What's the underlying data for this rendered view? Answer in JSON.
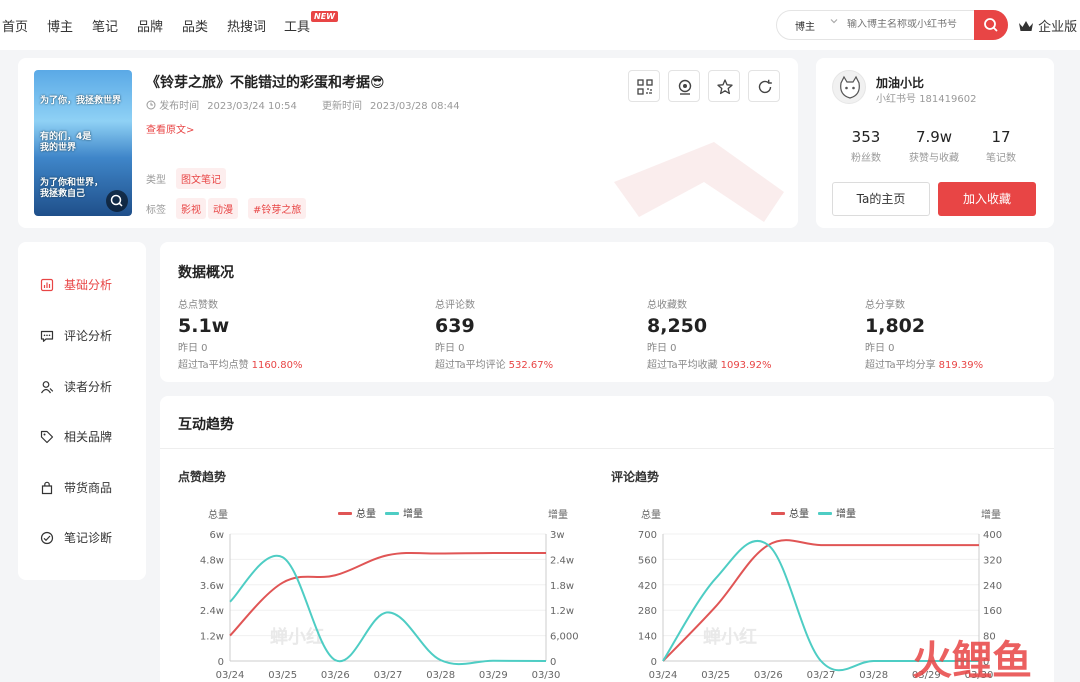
{
  "nav": {
    "items": [
      "首页",
      "博主",
      "笔记",
      "品牌",
      "品类",
      "热搜词",
      "工具"
    ],
    "new_badge": "NEW",
    "search": {
      "select": "博主",
      "placeholder": "输入博主名称或小红书号"
    },
    "enterprise": "企业版"
  },
  "note": {
    "title": "《铃芽之旅》不能错过的彩蛋和考据😎",
    "publish_label": "发布时间",
    "publish_time": "2023/03/24 10:54",
    "update_label": "更新时间",
    "update_time": "2023/03/28 08:44",
    "view_original": "查看原文>",
    "type_label": "类型",
    "type_value": "图文笔记",
    "tags_label": "标签",
    "tags": [
      "影视",
      "动漫",
      "#铃芽之旅"
    ],
    "cover_texts": [
      "为了你，我拯救世界",
      "有的们，4是我的世界",
      "为了你和世界，我拯救自己"
    ]
  },
  "blogger": {
    "name": "加油小比",
    "id_label": "小红书号",
    "id": "181419602",
    "stats": [
      {
        "value": "353",
        "label": "粉丝数"
      },
      {
        "value": "7.9w",
        "label": "获赞与收藏"
      },
      {
        "value": "17",
        "label": "笔记数"
      }
    ],
    "home_button": "Ta的主页",
    "fav_button": "加入收藏"
  },
  "sidebar": {
    "items": [
      {
        "label": "基础分析",
        "icon": "bar-chart-icon",
        "active": true
      },
      {
        "label": "评论分析",
        "icon": "comment-icon",
        "active": false
      },
      {
        "label": "读者分析",
        "icon": "user-icon",
        "active": false
      },
      {
        "label": "相关品牌",
        "icon": "tag-icon",
        "active": false
      },
      {
        "label": "带货商品",
        "icon": "bag-icon",
        "active": false
      },
      {
        "label": "笔记诊断",
        "icon": "diagnose-icon",
        "active": false
      }
    ]
  },
  "overview": {
    "title": "数据概况",
    "metrics": [
      {
        "label": "总点赞数",
        "value": "5.1w",
        "yesterday": "昨日 0",
        "compare": "超过Ta平均点赞",
        "pct": "1160.80%"
      },
      {
        "label": "总评论数",
        "value": "639",
        "yesterday": "昨日 0",
        "compare": "超过Ta平均评论",
        "pct": "532.67%"
      },
      {
        "label": "总收藏数",
        "value": "8,250",
        "yesterday": "昨日 0",
        "compare": "超过Ta平均收藏",
        "pct": "1093.92%"
      },
      {
        "label": "总分享数",
        "value": "1,802",
        "yesterday": "昨日 0",
        "compare": "超过Ta平均分享",
        "pct": "819.39%"
      }
    ]
  },
  "trend": {
    "title": "互动趋势",
    "watermark": "蝉小红",
    "corner_brand": "火鲤鱼"
  },
  "colors": {
    "accent": "#e84545",
    "total": "#e05555",
    "increment": "#4ecdc4"
  },
  "chart_data": [
    {
      "type": "line",
      "title": "点赞趋势",
      "x": [
        "03/24",
        "03/25",
        "03/26",
        "03/27",
        "03/28",
        "03/29",
        "03/30"
      ],
      "ylabel_left": "总量",
      "ylabel_right": "增量",
      "yticks_left": [
        "0",
        "1.2w",
        "2.4w",
        "3.6w",
        "4.8w",
        "6w"
      ],
      "yticks_right": [
        "0",
        "6,000",
        "1.2w",
        "1.8w",
        "2.4w",
        "3w"
      ],
      "ylim_left": [
        0,
        60000
      ],
      "ylim_right": [
        0,
        30000
      ],
      "legend": "top-center",
      "series": [
        {
          "name": "总量",
          "axis": "left",
          "values": [
            12000,
            37000,
            40500,
            50000,
            50800,
            51000,
            51000
          ]
        },
        {
          "name": "增量",
          "axis": "right",
          "values": [
            14000,
            24500,
            200,
            11500,
            200,
            50,
            0
          ]
        }
      ]
    },
    {
      "type": "line",
      "title": "评论趋势",
      "x": [
        "03/24",
        "03/25",
        "03/26",
        "03/27",
        "03/28",
        "03/29",
        "03/30"
      ],
      "ylabel_left": "总量",
      "ylabel_right": "增量",
      "yticks_left": [
        "0",
        "140",
        "280",
        "420",
        "560",
        "700"
      ],
      "yticks_right": [
        "0",
        "80",
        "160",
        "240",
        "320",
        "400"
      ],
      "ylim_left": [
        0,
        700
      ],
      "ylim_right": [
        0,
        400
      ],
      "legend": "top-center",
      "series": [
        {
          "name": "总量",
          "axis": "left",
          "values": [
            0,
            300,
            639,
            639,
            639,
            639,
            639
          ]
        },
        {
          "name": "增量",
          "axis": "right",
          "values": [
            0,
            260,
            365,
            0,
            0,
            0,
            0
          ]
        }
      ]
    }
  ]
}
